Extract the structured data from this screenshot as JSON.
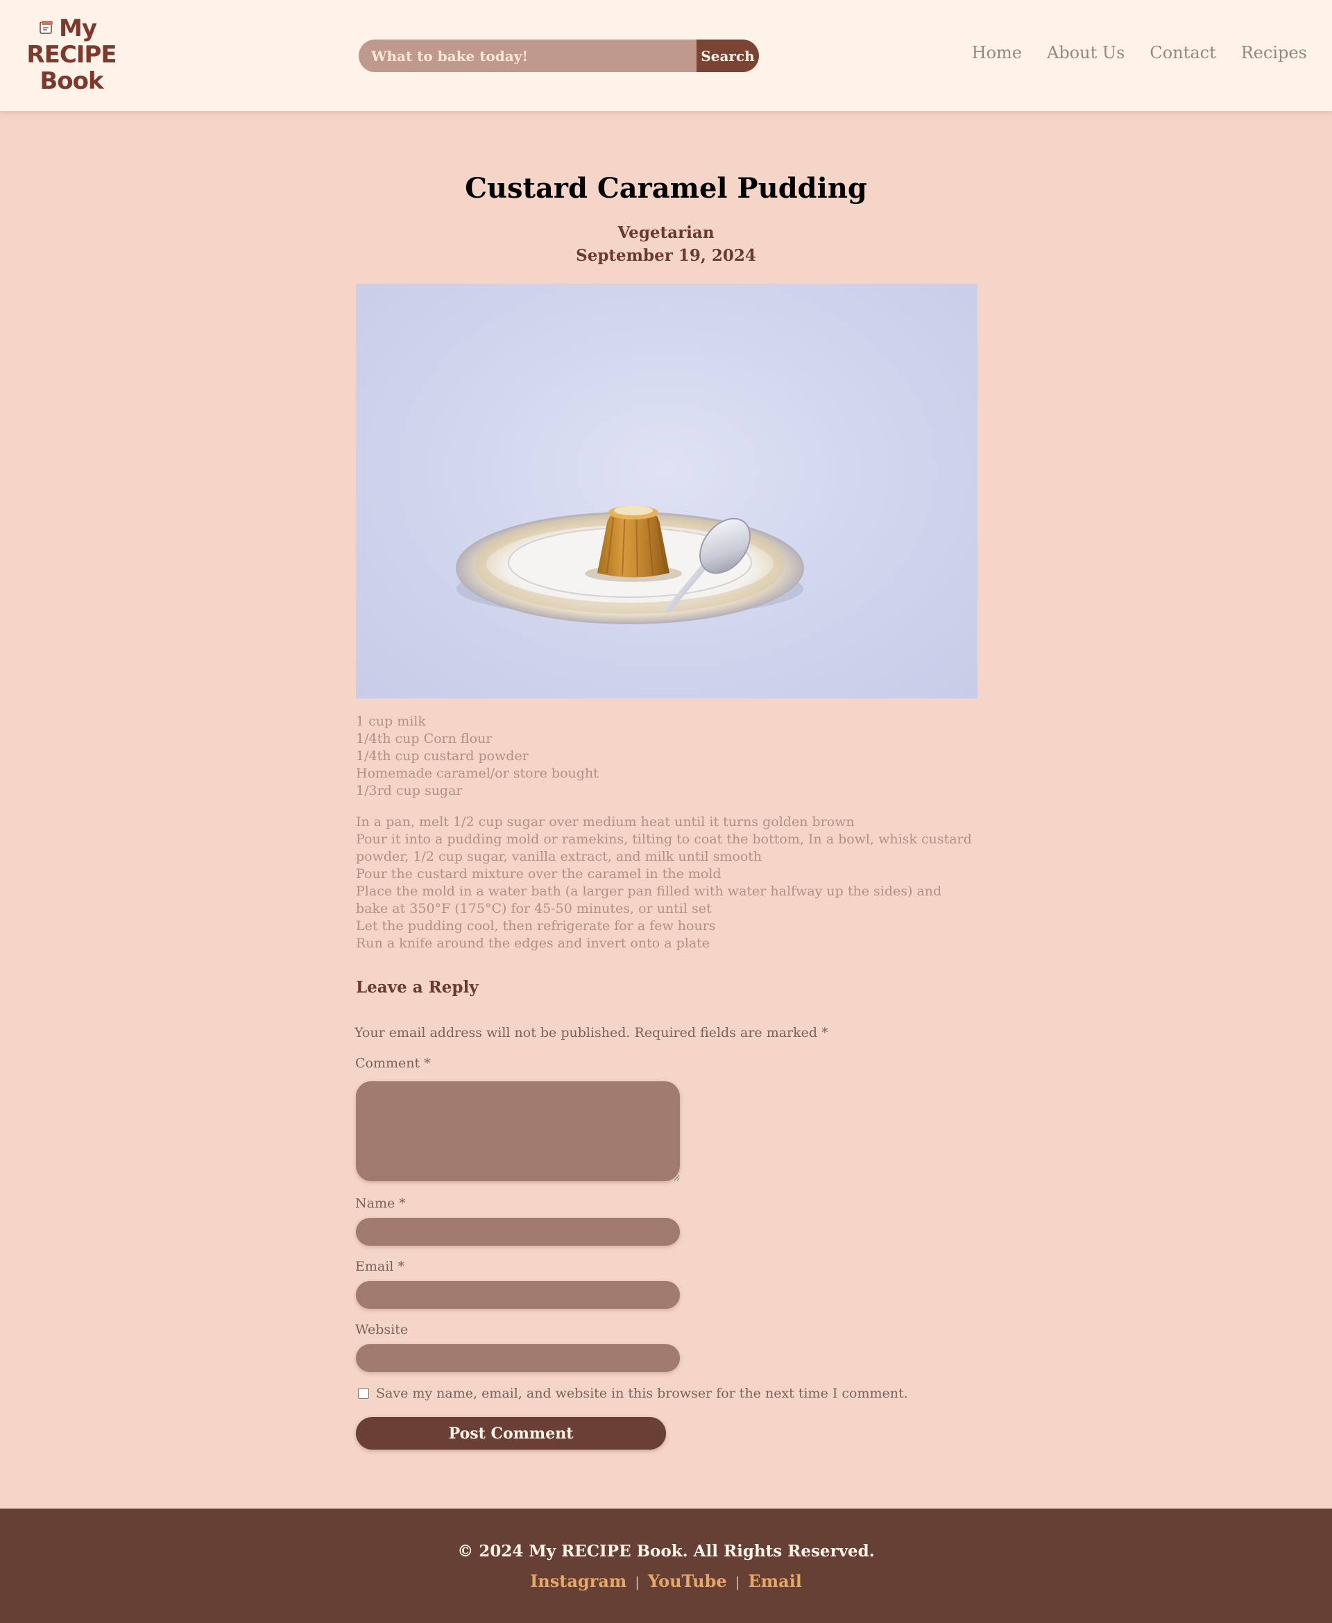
{
  "header": {
    "logo": {
      "line1": "My",
      "line2": "RECIPE",
      "line3": "Book"
    },
    "search": {
      "placeholder": "What to bake today!",
      "button_label": "Search"
    },
    "nav": [
      "Home",
      "About Us",
      "Contact",
      "Recipes"
    ]
  },
  "recipe": {
    "title": "Custard Caramel Pudding",
    "category": "Vegetarian",
    "date": "September 19, 2024",
    "ingredients": [
      "1 cup milk",
      "1/4th cup Corn flour",
      "1/4th cup custard powder",
      "Homemade caramel/or store bought",
      "1/3rd cup sugar"
    ],
    "steps": [
      "In a pan, melt 1/2 cup sugar over medium heat until it turns golden brown",
      "Pour it into a pudding mold or ramekins, tilting to coat the bottom, In a bowl, whisk custard powder, 1/2 cup sugar, vanilla extract, and milk until smooth",
      "Pour the custard mixture over the caramel in the mold",
      "Place the mold in a water bath (a larger pan filled with water halfway up the sides) and bake at 350°F (175°C) for 45-50 minutes, or until set",
      "Let the pudding cool, then refrigerate for a few hours",
      "Run a knife around the edges and invert onto a plate"
    ]
  },
  "reply": {
    "heading": "Leave a Reply",
    "note": "Your email address will not be published. Required fields are marked *",
    "comment_label": "Comment *",
    "name_label": "Name *",
    "email_label": "Email *",
    "website_label": "Website",
    "save_label": "Save my name, email, and website in this browser for the next time I comment.",
    "submit_label": "Post Comment"
  },
  "footer": {
    "copyright": "© 2024 My RECIPE Book. All Rights Reserved.",
    "links": [
      "Instagram",
      "YouTube",
      "Email"
    ],
    "separator": "|"
  },
  "colors": {
    "page_background": "#f5d5c8",
    "header_background": "#fff2e8",
    "accent_dark": "#663f35",
    "input_fill": "#a07a6d",
    "footer_link": "#e6a86a"
  },
  "icons": {
    "logo": "recipe-book-icon"
  }
}
